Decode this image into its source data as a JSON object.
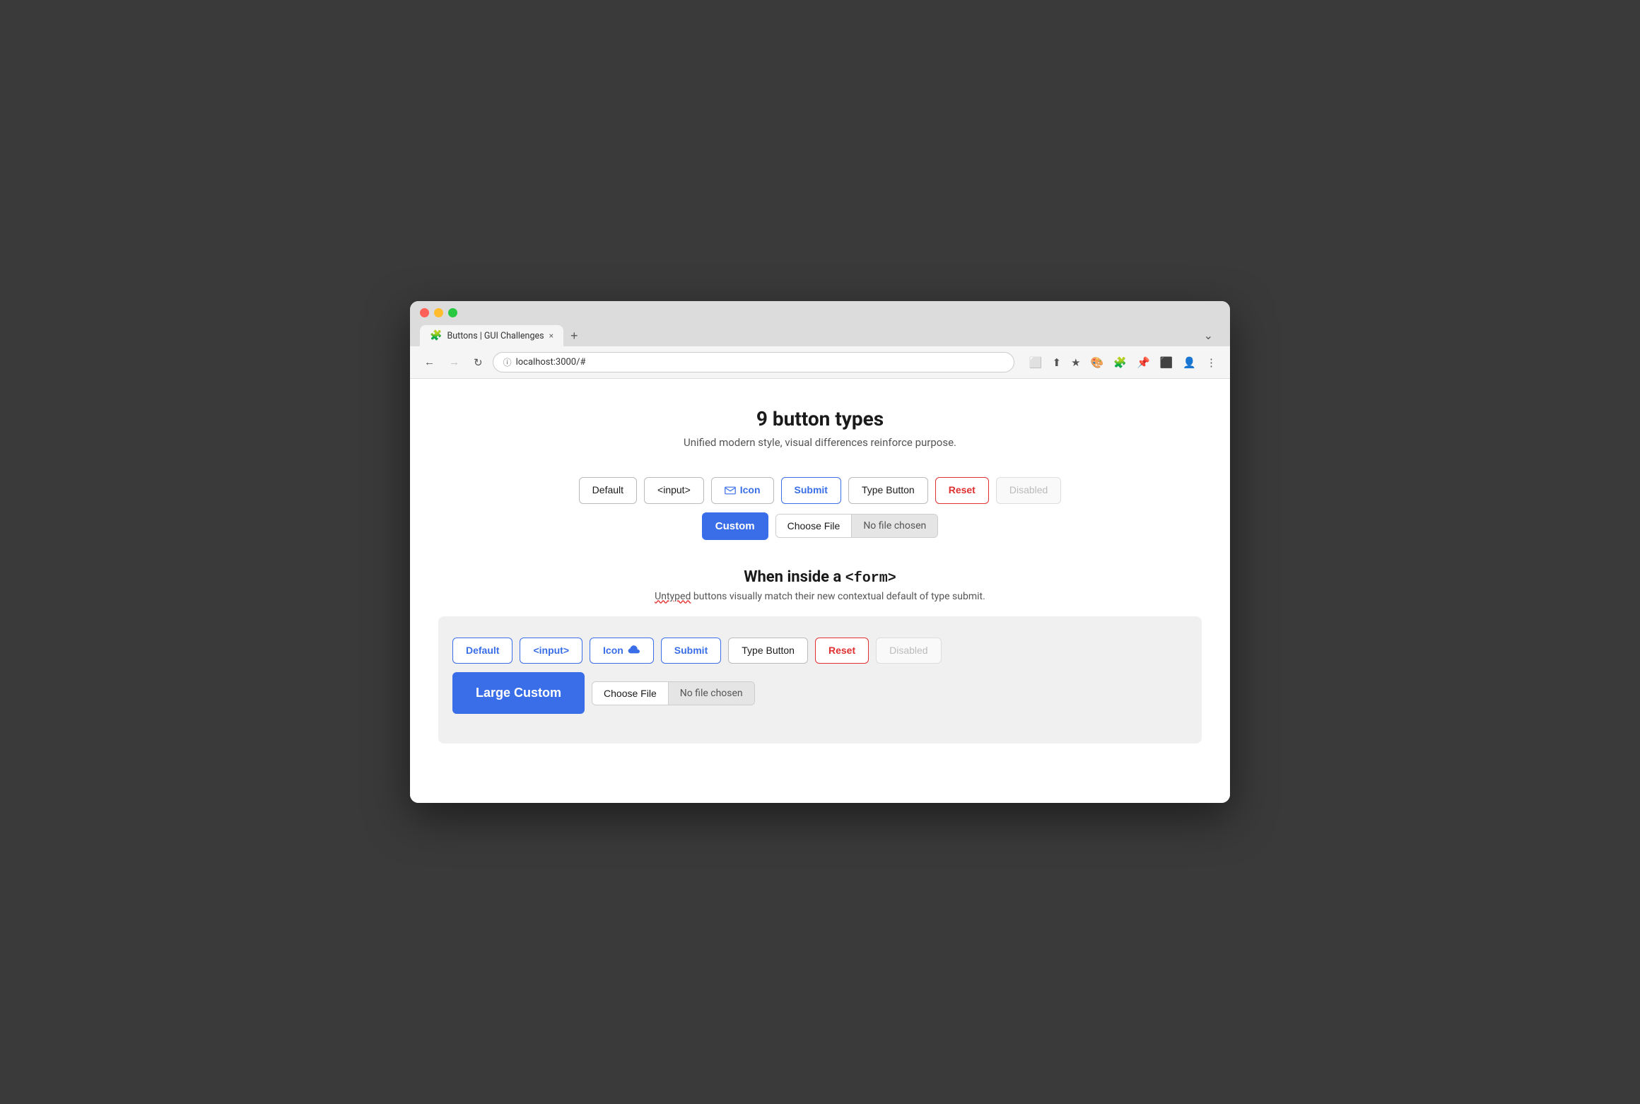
{
  "browser": {
    "traffic_lights": [
      "red",
      "yellow",
      "green"
    ],
    "tab_label": "Buttons | GUI Challenges",
    "tab_close": "×",
    "tab_new": "+",
    "tab_menu": "⌄",
    "nav_back": "←",
    "nav_forward": "→",
    "nav_refresh": "↻",
    "nav_url": "localhost:3000/#",
    "nav_url_icon": "ⓘ"
  },
  "page": {
    "title": "9 button types",
    "subtitle": "Unified modern style, visual differences reinforce purpose."
  },
  "top_row": {
    "buttons": [
      {
        "label": "Default",
        "type": "default"
      },
      {
        "label": "<input>",
        "type": "default"
      },
      {
        "label": "Icon",
        "type": "icon"
      },
      {
        "label": "Submit",
        "type": "submit"
      },
      {
        "label": "Type Button",
        "type": "default"
      },
      {
        "label": "Reset",
        "type": "reset"
      },
      {
        "label": "Disabled",
        "type": "disabled"
      }
    ],
    "custom_label": "Custom",
    "file_choose_label": "Choose File",
    "file_no_chosen_label": "No file chosen"
  },
  "form_section": {
    "title_prefix": "When inside a ",
    "title_tag": "<form>",
    "subtitle_untyped": "Untyped",
    "subtitle_rest": "buttons visually match their new contextual default of type submit.",
    "buttons": [
      {
        "label": "Default",
        "type": "default-form"
      },
      {
        "label": "<input>",
        "type": "default-form"
      },
      {
        "label": "Icon",
        "type": "icon-form"
      },
      {
        "label": "Submit",
        "type": "submit-form"
      },
      {
        "label": "Type Button",
        "type": "default"
      },
      {
        "label": "Reset",
        "type": "reset"
      },
      {
        "label": "Disabled",
        "type": "disabled"
      }
    ],
    "custom_label": "Large Custom",
    "file_choose_label": "Choose File",
    "file_no_chosen_label": "No file chosen"
  }
}
